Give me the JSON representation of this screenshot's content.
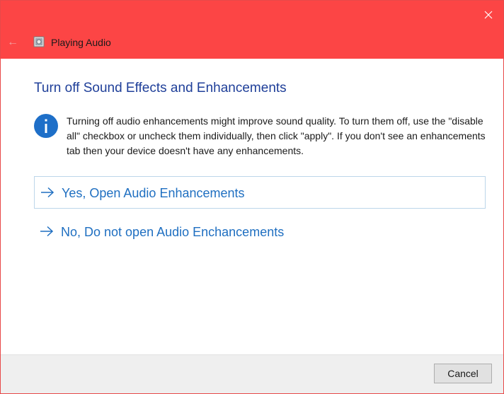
{
  "window": {
    "title": "Playing Audio",
    "close_glyph": "×",
    "back_glyph": "←",
    "titlebar_color": "#fc4545"
  },
  "content": {
    "heading": "Turn off Sound Effects and Enhancements",
    "info_icon": "info-icon",
    "info_text": "Turning off audio enhancements might improve sound quality. To turn them off, use the \"disable all\" checkbox or uncheck them individually, then click \"apply\". If you don't see an enhancements tab then your device doesn't have any enhancements.",
    "options": [
      {
        "label": "Yes, Open Audio Enhancements",
        "selected": true
      },
      {
        "label": "No, Do not open Audio Enchancements",
        "selected": false
      }
    ],
    "link_color": "#1f6fc1",
    "heading_color": "#1f3f99"
  },
  "footer": {
    "cancel_label": "Cancel"
  }
}
